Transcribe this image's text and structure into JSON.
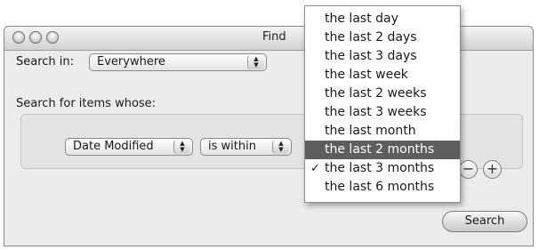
{
  "window": {
    "title": "Find"
  },
  "search_in": {
    "label": "Search in:",
    "value": "Everywhere"
  },
  "search_for": {
    "label": "Search for items whose:"
  },
  "criteria": {
    "attribute": "Date Modified",
    "operator": "is within"
  },
  "buttons": {
    "remove": "−",
    "add": "+",
    "search": "Search"
  },
  "menu": {
    "items": [
      {
        "label": "the last day"
      },
      {
        "label": "the last 2 days"
      },
      {
        "label": "the last 3 days"
      },
      {
        "label": "the last week"
      },
      {
        "label": "the last 2 weeks"
      },
      {
        "label": "the last 3 weeks"
      },
      {
        "label": "the last month"
      },
      {
        "label": "the last 2 months"
      },
      {
        "label": "the last 3 months"
      },
      {
        "label": "the last 6 months"
      }
    ],
    "highlighted_item": "the last 2 months",
    "selected_item": "the last 3 months",
    "check_glyph": "✓"
  },
  "colors": {
    "menu_highlight": "#5e5e5e",
    "window_bg": "#ececec"
  }
}
